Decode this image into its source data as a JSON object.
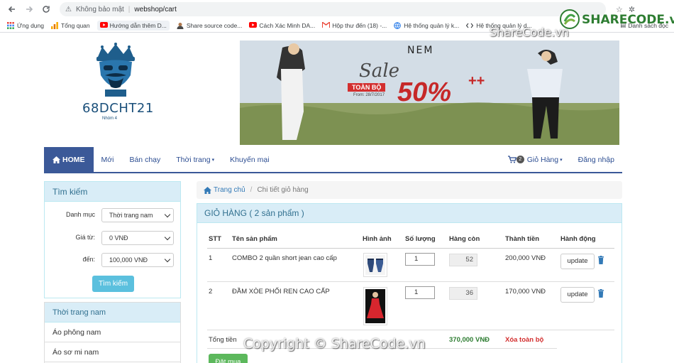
{
  "browser": {
    "security_label": "Không bảo mật",
    "url_path": "webshop/cart",
    "bookmarks": [
      {
        "label": "Ứng dụng"
      },
      {
        "label": "Tổng quan"
      },
      {
        "label": "Hướng dẫn thêm D..."
      },
      {
        "label": "Share source code..."
      },
      {
        "label": "Cách Xác Minh DA..."
      },
      {
        "label": "Hộp thư đến (18) -..."
      },
      {
        "label": "Hệ thống quản lý k..."
      },
      {
        "label": "Hệ thống quản lý d..."
      }
    ],
    "reading_list": "Danh sách đọc"
  },
  "logo": {
    "text": "68DCHT21",
    "sub": "Nhóm 4"
  },
  "banner": {
    "brand": "NEM",
    "sale_word": "Sale",
    "sale_tag": "TOÀN BỘ",
    "sale_date": "From: 28/7/2017",
    "sale_percent": "50%",
    "sale_plus": "++"
  },
  "nav": {
    "home": "HOME",
    "items": [
      "Mới",
      "Bán chạy",
      "Thời trang",
      "Khuyến mại"
    ],
    "cart_count": "2",
    "cart_label": "Giỏ Hàng",
    "login": "Đăng nhập"
  },
  "search_panel": {
    "title": "Tìm kiếm",
    "category_label": "Danh mục",
    "category_value": "Thời trang nam",
    "price_from_label": "Giá từ:",
    "price_from_value": "0 VNĐ",
    "price_to_label": "đến:",
    "price_to_value": "100,000 VNĐ",
    "button": "Tìm kiếm"
  },
  "category_panel": {
    "title": "Thời trang nam",
    "items": [
      "Áo phông nam",
      "Áo sơ mi nam"
    ]
  },
  "breadcrumb": {
    "home": "Trang chủ",
    "current": "Chi tiết giỏ hàng"
  },
  "cart": {
    "title": "GIỎ HÀNG ( 2 sản phẩm )",
    "headers": {
      "stt": "STT",
      "name": "Tên sản phẩm",
      "image": "Hình ảnh",
      "qty": "Số lượng",
      "stock": "Hàng còn",
      "subtotal": "Thành tiền",
      "action": "Hành động"
    },
    "rows": [
      {
        "stt": "1",
        "name": "COMBO 2 quần short jean cao cấp",
        "qty": "1",
        "stock": "52",
        "subtotal": "200,000 VNĐ",
        "update": "update"
      },
      {
        "stt": "2",
        "name": "ĐẦM XÒE PHỐI REN CAO CẤP",
        "qty": "1",
        "stock": "36",
        "subtotal": "170,000 VNĐ",
        "update": "update"
      }
    ],
    "total_label": "Tổng tiền",
    "total_value": "370,000 VNĐ",
    "clear_all": "Xóa toàn bộ",
    "order_button": "Đặt mua"
  },
  "watermark": {
    "top": "SHARECODE.vn",
    "top_url": "ShareCode.vn",
    "bottom": "Copyright © ShareCode.vn"
  },
  "colors": {
    "nav_blue": "#3b5998",
    "panel_head": "#d9edf7",
    "info_button": "#5bc0de",
    "success_button": "#5cb85c",
    "total_green": "#2e7d32",
    "clear_red": "#d32f2f"
  }
}
